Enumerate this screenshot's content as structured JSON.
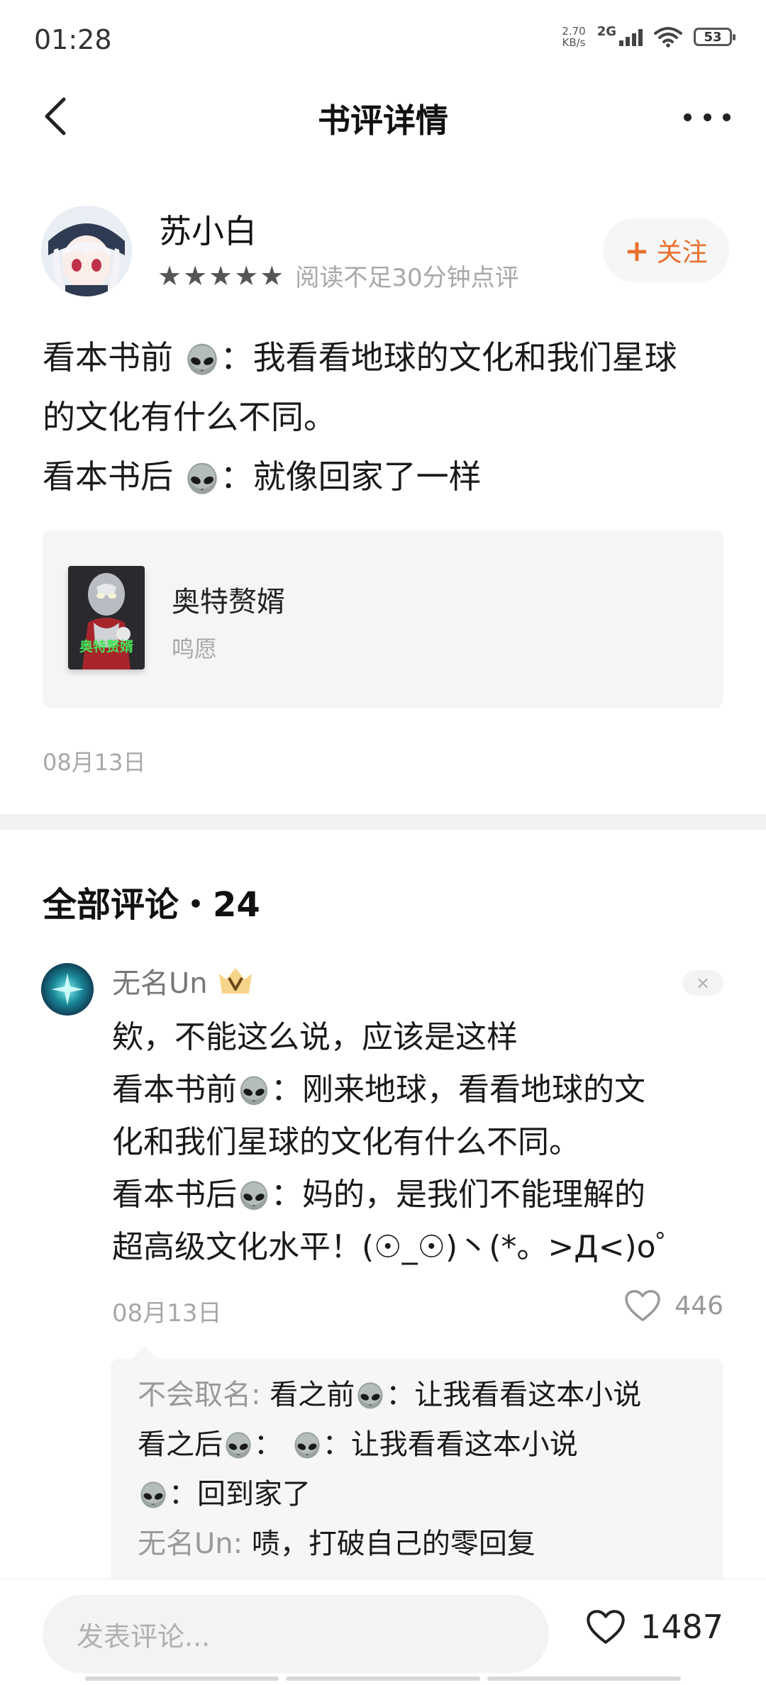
{
  "status_bar": {
    "time": "01:28",
    "net_speed_value": "2.70",
    "net_speed_unit": "KB/s",
    "signal_label": "2G",
    "battery": "53"
  },
  "nav": {
    "title": "书评详情"
  },
  "review": {
    "author": "苏小白",
    "stars": "★★★★★",
    "rating_note": "阅读不足30分钟点评",
    "follow_label": "关注",
    "line1_before": "看本书前",
    "line1_after": "：我看看地球的文化和我们星球",
    "line2": "的文化有什么不同。",
    "line3_before": "看本书后",
    "line3_after": "：就像回家了一样",
    "date": "08月13日"
  },
  "book": {
    "title": "奥特赘婿",
    "author": "鸣愿",
    "cover_text": "奥特赘婿"
  },
  "comments": {
    "heading": "全部评论・24",
    "items": [
      {
        "author": "无名Un",
        "line1": "欸，不能这么说，应该是这样",
        "line2_before": "看本书前",
        "line2_after": "：刚来地球，看看地球的文",
        "line3": "化和我们星球的文化有什么不同。",
        "line4_before": "看本书后",
        "line4_after": "：妈的，是我们不能理解的",
        "line5": "超高级文化水平！(☉_☉)丶(*。>Д<)o゜",
        "date": "08月13日",
        "likes": "446",
        "close_label": "×",
        "replies": {
          "r1_name": "不会取名:",
          "r1_before": " 看之前",
          "r1_after": "：让我看看这本小说",
          "r2_before": "看之后",
          "r2_middle": "：",
          "r2_after": "：让我看看这本小说",
          "r3_after": "：回到家了",
          "r4_name": "无名Un:",
          "r4_text": " 啧，打破自己的零回复"
        }
      }
    ]
  },
  "bottom_bar": {
    "input_placeholder": "发表评论...",
    "likes": "1487"
  },
  "icons": {
    "back": "back-arrow-icon",
    "more": "more-dots-icon",
    "alien": "alien-emoji-icon",
    "heart": "heart-outline-icon",
    "plus": "plus-icon",
    "vip": "crown-v-badge-icon"
  },
  "colors": {
    "accent": "#e8702e",
    "muted_text": "#a8a8a8",
    "card_bg": "#f5f5f5"
  }
}
